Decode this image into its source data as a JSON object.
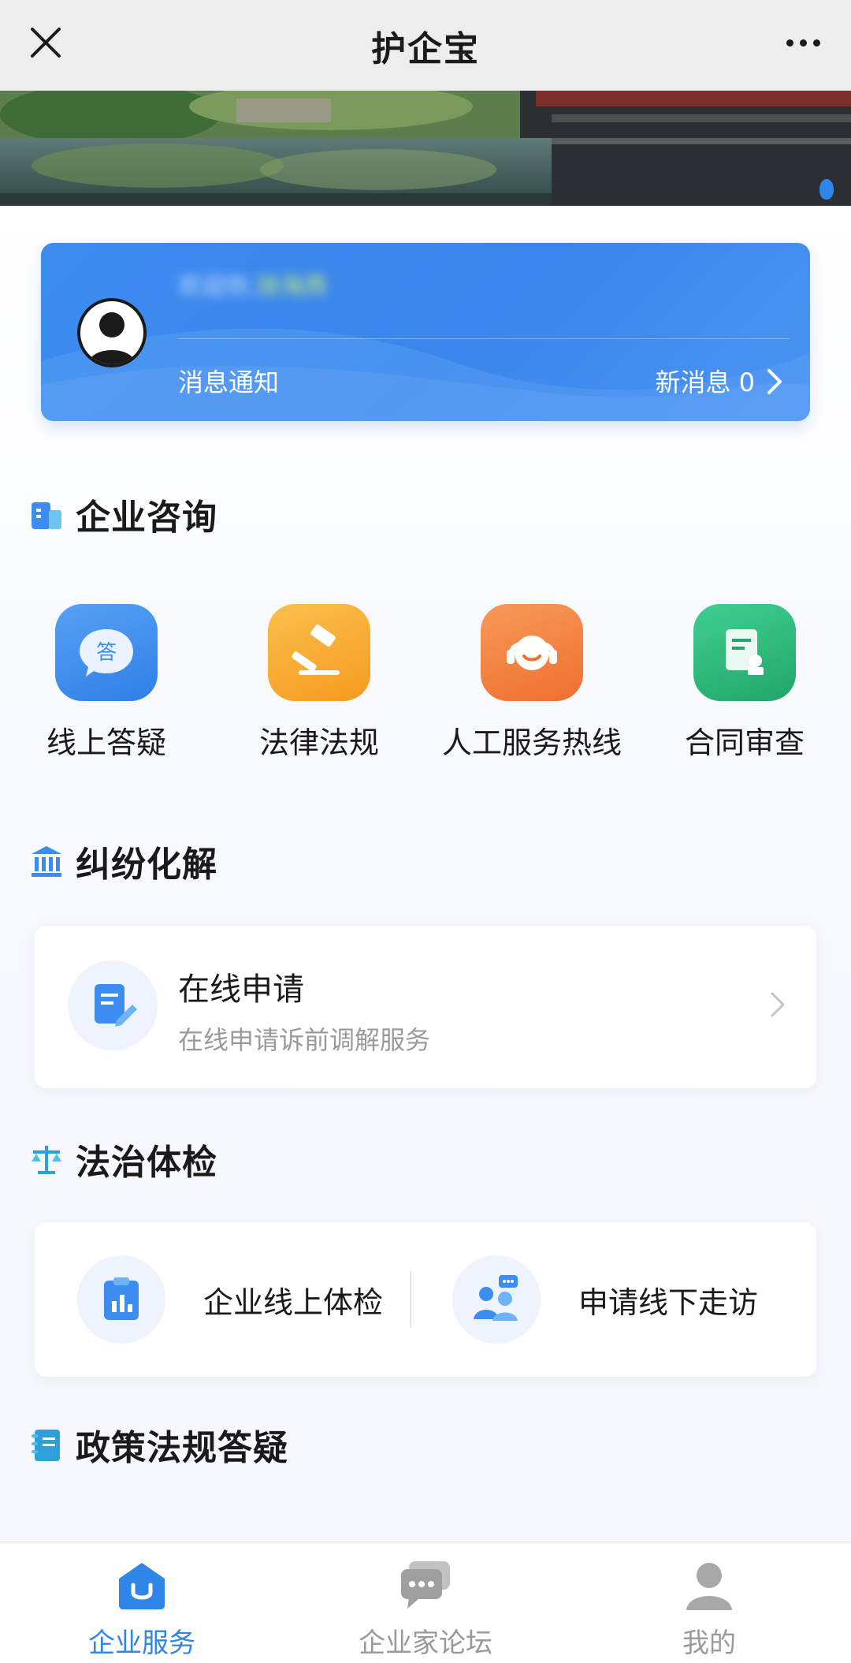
{
  "app": {
    "title": "护企宝"
  },
  "welcome": {
    "greeting_prefix": "欢迎你,",
    "greeting_name": "徐海燕",
    "notice_label": "消息通知",
    "new_message_label": "新消息 0"
  },
  "sections": {
    "consult": {
      "title": "企业咨询",
      "items": [
        {
          "label": "线上答疑",
          "tile_text": "答",
          "color": "#3d8cf0"
        },
        {
          "label": "法律法规",
          "color": "#f5a623"
        },
        {
          "label": "人工服务热线",
          "color": "#f07a3c"
        },
        {
          "label": "合同审查",
          "color": "#2fb67a"
        }
      ]
    },
    "dispute": {
      "title": "纠纷化解",
      "apply_title": "在线申请",
      "apply_subtitle": "在线申请诉前调解服务"
    },
    "checkup": {
      "title": "法治体检",
      "items": [
        {
          "label": "企业线上体检"
        },
        {
          "label": "申请线下走访"
        }
      ]
    },
    "policy": {
      "title": "政策法规答疑"
    }
  },
  "tabbar": {
    "active_color": "#2f86e8",
    "inactive_color": "#9a9a9a",
    "tabs": [
      {
        "label": "企业服务",
        "active": true
      },
      {
        "label": "企业家论坛",
        "active": false
      },
      {
        "label": "我的",
        "active": false
      }
    ]
  }
}
